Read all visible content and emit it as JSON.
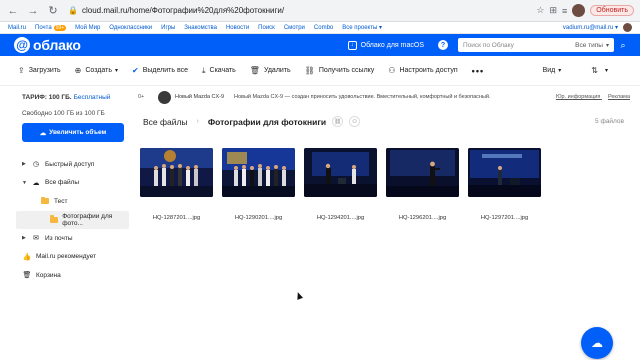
{
  "browser": {
    "url": "cloud.mail.ru/home/Фотографии%20для%20фотокниги/",
    "update_label": "Обновить"
  },
  "portal": {
    "links": [
      "Mail.ru",
      "Почта",
      "Мой Мир",
      "Одноклассники",
      "Игры",
      "Знакомства",
      "Новости",
      "Поиск",
      "Смотри",
      "Combo",
      "Все проекты ▾"
    ],
    "mail_badge": "99+",
    "user": "vadium.ru@mail.ru ▾"
  },
  "header": {
    "logo_text": "облако",
    "mac_label": "Облако для macOS",
    "help": "?",
    "search_placeholder": "Поиск по Облаку",
    "search_types": "Все типы"
  },
  "toolbar": {
    "upload": "Загрузить",
    "create": "Создать",
    "select_all": "Выделить все",
    "download": "Скачать",
    "delete": "Удалить",
    "get_link": "Получить ссылку",
    "access": "Настроить доступ",
    "more": "•••",
    "view": "Вид"
  },
  "sidebar": {
    "tariff_label": "ТАРИФ: 100 ГБ.",
    "tariff_link": "Бесплатный",
    "free_space": "Свободно 100 ГБ из 100 ГБ",
    "upgrade": "Увеличить объем",
    "items": [
      {
        "label": "Быстрый доступ"
      },
      {
        "label": "Все файлы"
      },
      {
        "label": "Тест"
      },
      {
        "label": "Фотографии для фото..."
      },
      {
        "label": "Из почты"
      },
      {
        "label": "Mail.ru рекомендует"
      },
      {
        "label": "Корзина"
      }
    ]
  },
  "ad": {
    "counter": "0+",
    "title": "Новый Mazda CX-9",
    "text": "Новый Mazda CX-9 — создан приносить удовольствие. Вместительный, комфортный и безопасный.",
    "legal": "Юр. информация",
    "label": "Реклама"
  },
  "breadcrumbs": {
    "root": "Все файлы",
    "current": "Фотографии для фотокниги",
    "count": "5 файлов"
  },
  "files": [
    {
      "name": "HQ-1287201....jpg"
    },
    {
      "name": "HQ-1290201....jpg"
    },
    {
      "name": "HQ-1294201....jpg"
    },
    {
      "name": "HQ-1296201....jpg"
    },
    {
      "name": "HQ-1297201....jpg"
    }
  ],
  "colors": {
    "brand_blue": "#005ff9",
    "folder": "#f5b73d"
  }
}
